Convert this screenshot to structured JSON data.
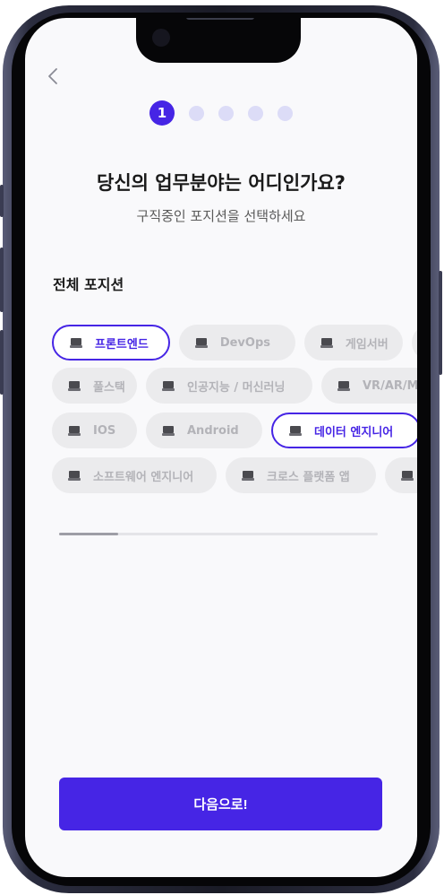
{
  "header": {
    "back_icon": "chevron-left-icon",
    "back_label": "<"
  },
  "steps": {
    "current": "1",
    "total": 5
  },
  "title": "당신의 업무분야는 어디인가요?",
  "subtitle": "구직중인 포지션을 선택하세요",
  "section_label": "전체 포지션",
  "chip_icon": "laptop-icon",
  "chips": {
    "row1": [
      "프론트엔드",
      "DevOps",
      "게임서버",
      ""
    ],
    "row2": [
      "풀스택",
      "인공지능 / 머신러닝",
      "VR/AR/M"
    ],
    "row3": [
      "IOS",
      "Android",
      "데이터 엔지니어"
    ],
    "row4": [
      "소프트웨어 엔지니어",
      "크로스 플랫폼 앱",
      ""
    ]
  },
  "selected": [
    "프론트엔드",
    "데이터 엔지니어"
  ],
  "scroll": {
    "position_fraction": 0.19
  },
  "next_button": "다음으로!",
  "colors": {
    "accent": "#4625e5",
    "chip_bg": "#ebebed",
    "chip_text": "#b3b3b8",
    "screen_bg": "#f9f9fb"
  }
}
